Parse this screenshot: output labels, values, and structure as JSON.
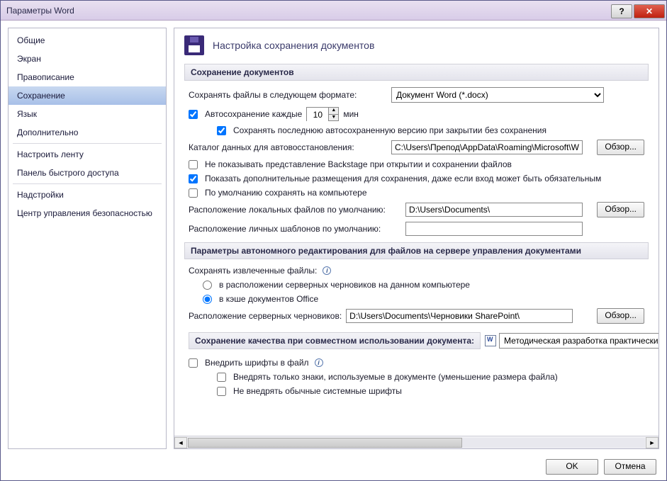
{
  "window": {
    "title": "Параметры Word"
  },
  "sidebar": {
    "items": [
      {
        "label": "Общие",
        "selected": false
      },
      {
        "label": "Экран",
        "selected": false
      },
      {
        "label": "Правописание",
        "selected": false
      },
      {
        "label": "Сохранение",
        "selected": true
      },
      {
        "label": "Язык",
        "selected": false
      },
      {
        "label": "Дополнительно",
        "selected": false
      },
      {
        "label": "Настроить ленту",
        "selected": false
      },
      {
        "label": "Панель быстрого доступа",
        "selected": false
      },
      {
        "label": "Надстройки",
        "selected": false
      },
      {
        "label": "Центр управления безопасностью",
        "selected": false
      }
    ]
  },
  "main": {
    "header_title": "Настройка сохранения документов",
    "section_save_docs": "Сохранение документов",
    "save_format_label": "Сохранять файлы в следующем формате:",
    "save_format_value": "Документ Word (*.docx)",
    "autosave_label": "Автосохранение каждые",
    "autosave_value": "10",
    "autosave_unit": "мин",
    "autosave_checked": true,
    "keep_last_label": "Сохранять последнюю автосохраненную версию при закрытии без сохранения",
    "keep_last_checked": true,
    "autorecover_path_label": "Каталог данных для автовосстановления:",
    "autorecover_path_value": "C:\\Users\\Препод\\AppData\\Roaming\\Microsoft\\Word\\",
    "browse_btn": "Обзор...",
    "no_backstage_label": "Не показывать представление Backstage при открытии и сохранении файлов",
    "no_backstage_checked": false,
    "show_extra_locations_label": "Показать дополнительные размещения для сохранения, даже если вход может быть обязательным",
    "show_extra_locations_checked": true,
    "save_local_default_label": "По умолчанию сохранять на компьютере",
    "save_local_default_checked": false,
    "local_files_label": "Расположение локальных файлов по умолчанию:",
    "local_files_value": "D:\\Users\\Documents\\",
    "personal_templates_label": "Расположение личных шаблонов по умолчанию:",
    "personal_templates_value": "",
    "section_offline": "Параметры автономного редактирования для файлов на сервере управления документами",
    "save_checked_out_label": "Сохранять извлеченные файлы:",
    "radio_server_drafts": "в расположении серверных черновиков на данном компьютере",
    "radio_office_cache": "в кэше документов Office",
    "radio_selected": "cache",
    "server_drafts_path_label": "Расположение серверных черновиков:",
    "server_drafts_path_value": "D:\\Users\\Documents\\Черновики SharePoint\\",
    "section_fidelity": "Сохранение качества при совместном использовании документа:",
    "fidelity_doc_value": "Методическая разработка практических ...",
    "embed_fonts_label": "Внедрить шрифты в файл",
    "embed_fonts_checked": false,
    "embed_used_only_label": "Внедрять только знаки, используемые в документе (уменьшение размера файла)",
    "embed_used_only_checked": false,
    "no_system_fonts_label": "Не внедрять обычные системные шрифты",
    "no_system_fonts_checked": false
  },
  "footer": {
    "ok": "OK",
    "cancel": "Отмена"
  }
}
